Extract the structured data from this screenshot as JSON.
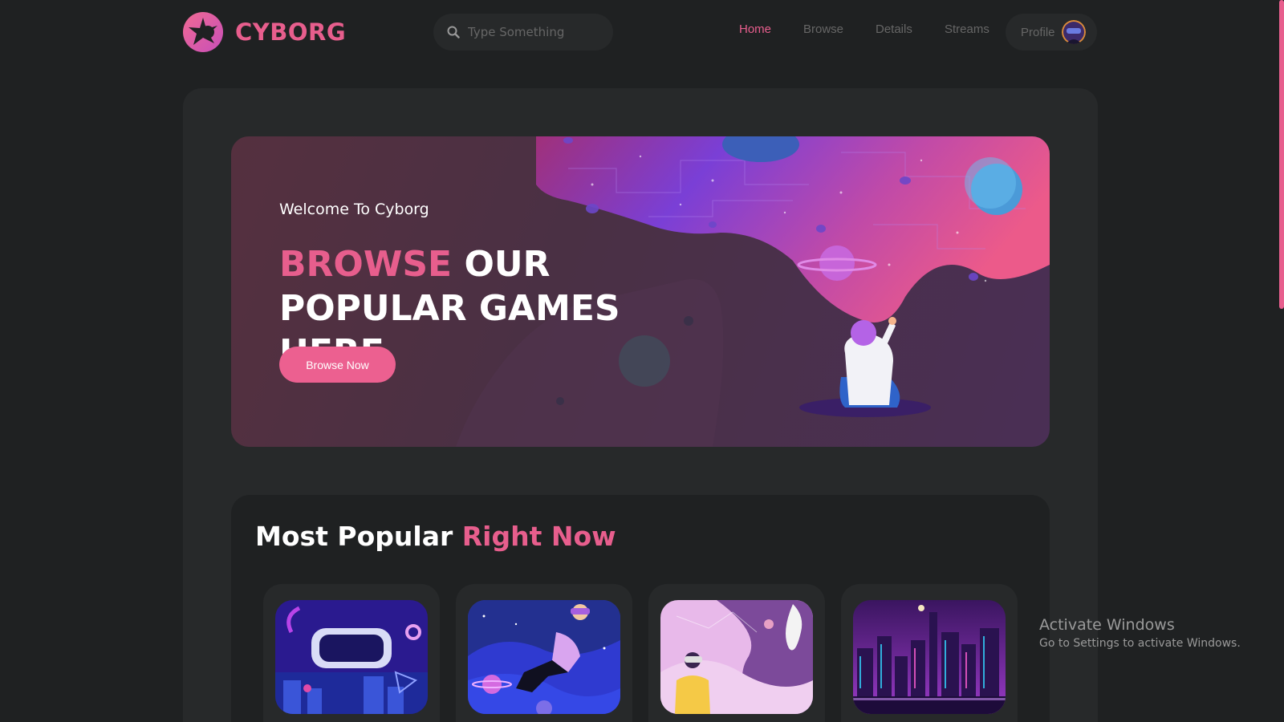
{
  "brand": {
    "name": "CYBORG",
    "accent": "#e75e8d"
  },
  "search": {
    "placeholder": "Type Something"
  },
  "nav": {
    "items": [
      {
        "label": "Home",
        "active": true
      },
      {
        "label": "Browse",
        "active": false
      },
      {
        "label": "Details",
        "active": false
      },
      {
        "label": "Streams",
        "active": false
      }
    ],
    "profile_label": "Profile"
  },
  "banner": {
    "welcome": "Welcome To Cyborg",
    "heading_highlight": "BROWSE",
    "heading_rest_line1": "OUR",
    "heading_line2": "POPULAR GAMES HERE",
    "button_label": "Browse Now"
  },
  "popular": {
    "title_plain": "Most Popular",
    "title_highlight": "Right Now",
    "cards": [
      {
        "art": "vr-headset-city"
      },
      {
        "art": "floating-vr-player"
      },
      {
        "art": "girl-stargazing-astronaut"
      },
      {
        "art": "neon-city-night"
      }
    ]
  },
  "watermark": {
    "line1": "Activate Windows",
    "line2": "Go to Settings to activate Windows."
  }
}
